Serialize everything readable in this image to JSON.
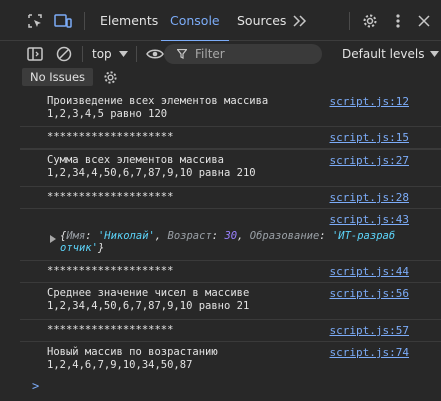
{
  "tabs": {
    "elements": "Elements",
    "console": "Console",
    "sources": "Sources"
  },
  "toolbar": {
    "context": "top",
    "filter_placeholder": "Filter",
    "levels": "Default levels"
  },
  "issues": {
    "label": "No Issues"
  },
  "messages": [
    {
      "line1": "Произведение всех элементов массива",
      "line2": "1,2,3,4,5 равно 120",
      "source": "script.js:12"
    },
    {
      "line1": "********************",
      "source": "script.js:15"
    },
    {
      "line1": "Сумма всех элементов массива",
      "line2": "1,2,34,4,50,6,7,87,9,10 равна 210",
      "source": "script.js:27"
    },
    {
      "line1": "********************",
      "source": "script.js:28"
    },
    {
      "source": "script.js:43",
      "object": {
        "open": "{",
        "k1": "Имя",
        "v1": "'Николай'",
        "k2": "Возраст",
        "v2": "30",
        "k3": "Образование",
        "v3a": "'ИТ-разраб",
        "v3b": "отчик'",
        "close": "}"
      }
    },
    {
      "line1": "********************",
      "source": "script.js:44"
    },
    {
      "line1": "Среднее значение чисел в массиве",
      "line2": "1,2,34,4,50,6,7,87,9,10 равно 21",
      "source": "script.js:56"
    },
    {
      "line1": "********************",
      "source": "script.js:57"
    },
    {
      "line1": "Новый массив по возрастанию",
      "line2": "1,2,4,6,7,9,10,34,50,87",
      "source": "script.js:74"
    }
  ],
  "prompt": ">",
  "colors": {
    "accent": "#7cacf8",
    "background": "#282828",
    "string": "#5cd5fb",
    "number": "#9980ff"
  }
}
